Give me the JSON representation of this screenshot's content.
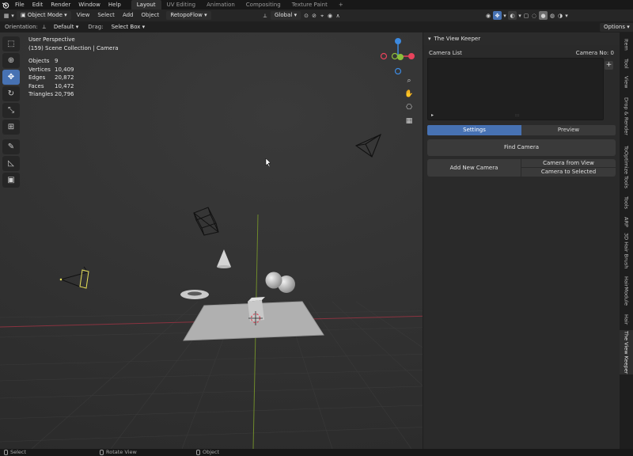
{
  "menu": {
    "items": [
      "File",
      "Edit",
      "Render",
      "Window",
      "Help"
    ],
    "workspaces": [
      "Layout",
      "UV Editing",
      "Animation",
      "Compositing",
      "Texture Paint"
    ],
    "active_workspace": "Layout",
    "add_workspace": "+"
  },
  "header": {
    "mode": "Object Mode",
    "view": "View",
    "select": "Select",
    "add": "Add",
    "object": "Object",
    "addon": "RetopoFlow",
    "orientation_dd": "Global",
    "options": "Options"
  },
  "tool_settings": {
    "orientation_label": "Orientation:",
    "orientation_value": "Default",
    "drag_label": "Drag:",
    "drag_value": "Select Box"
  },
  "viewport_overlay": {
    "perspective": "User Perspective",
    "collection": "(159) Scene Collection | Camera",
    "stats": [
      {
        "key": "Objects",
        "value": "9"
      },
      {
        "key": "Vertices",
        "value": "10,409"
      },
      {
        "key": "Edges",
        "value": "20,872"
      },
      {
        "key": "Faces",
        "value": "10,472"
      },
      {
        "key": "Triangles",
        "value": "20,796"
      }
    ]
  },
  "gizmo": {
    "z": "Z",
    "y": "Y",
    "x": "X",
    "colors": {
      "x": "#e8435c",
      "y": "#8bbf3b",
      "z": "#3d8ae0"
    }
  },
  "tools": [
    "tweak-icon",
    "cursor-icon",
    "move-icon",
    "rotate-icon",
    "scale-icon",
    "transform-icon",
    "annotate-icon",
    "measure-icon",
    "add-cube-icon"
  ],
  "panel": {
    "title": "The View Keeper",
    "camera_list_label": "Camera List",
    "camera_no_label": "Camera No:",
    "camera_no_value": "0",
    "add_icon": "+",
    "tabs": [
      "Settings",
      "Preview"
    ],
    "active_tab": "Settings",
    "find_camera": "Find Camera",
    "add_new_camera": "Add New Camera",
    "camera_from_view": "Camera from View",
    "camera_to_selected": "Camera to Selected"
  },
  "side_tabs": [
    "Item",
    "Tool",
    "View",
    "Drop & Render",
    "ToOptimize Tools",
    "Tools",
    "ARP",
    "3D Hair Brush",
    "HairModule",
    "Hair",
    "The View Keeper"
  ],
  "active_side_tab": "The View Keeper",
  "status": {
    "select": "Select",
    "rotate": "Rotate View",
    "object": "Object"
  },
  "colors": {
    "accent": "#4772b3",
    "x_axis": "#8a3340",
    "y_axis": "#6f8a2b"
  }
}
